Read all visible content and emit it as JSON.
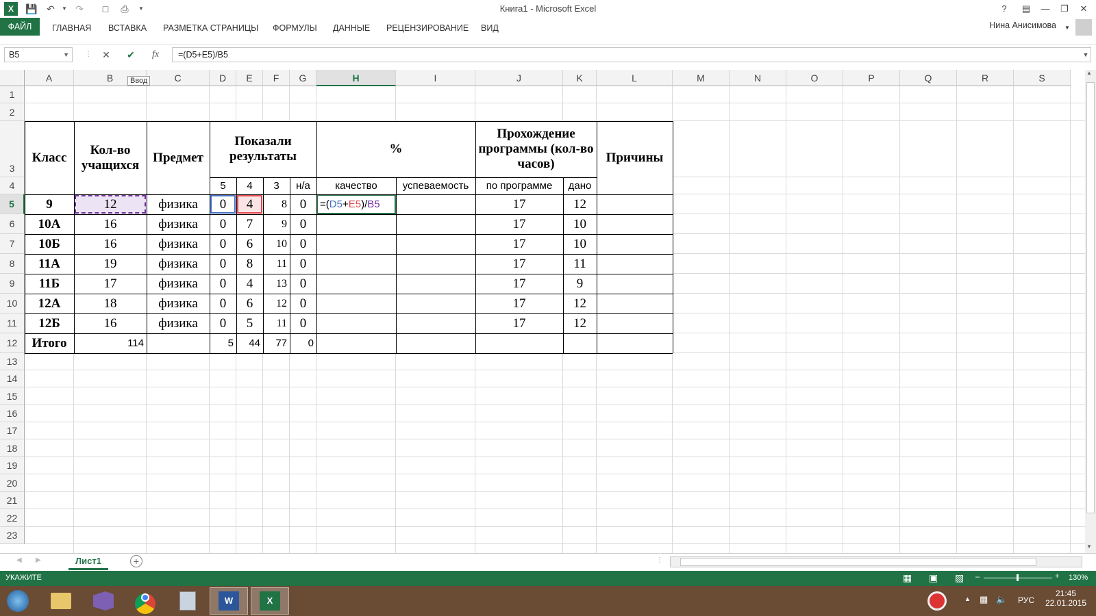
{
  "window": {
    "title": "Книга1 - Microsoft Excel"
  },
  "ribbon": {
    "file": "ФАЙЛ",
    "tabs": [
      "ГЛАВНАЯ",
      "ВСТАВКА",
      "РАЗМЕТКА СТРАНИЦЫ",
      "ФОРМУЛЫ",
      "ДАННЫЕ",
      "РЕЦЕНЗИРОВАНИЕ",
      "ВИД"
    ],
    "user": "Нина Анисимова"
  },
  "formula_bar": {
    "name_box": "B5",
    "formula": "=(D5+E5)/B5",
    "fx": "fx"
  },
  "tooltip": "Ввод",
  "columns": [
    "A",
    "B",
    "C",
    "D",
    "E",
    "F",
    "G",
    "H",
    "I",
    "J",
    "K",
    "L",
    "M",
    "N",
    "O",
    "P",
    "Q",
    "R",
    "S"
  ],
  "rows": [
    "1",
    "2",
    "3",
    "4",
    "5",
    "6",
    "7",
    "8",
    "9",
    "10",
    "11",
    "12",
    "13",
    "14",
    "15",
    "16",
    "17",
    "18",
    "19",
    "20",
    "21",
    "22",
    "23"
  ],
  "table": {
    "h_class": "Класс",
    "h_count": "Кол-во учащихся",
    "h_subject": "Предмет",
    "h_results": "Показали результаты",
    "h_percent": "%",
    "h_program": "Прохождение программы (кол-во часов)",
    "h_reasons": "Причины",
    "sub": {
      "g5": "5",
      "g4": "4",
      "g3": "3",
      "na": "н/а",
      "quality": "качество",
      "success": "успеваемость",
      "by_program": "по программе",
      "given": "дано"
    },
    "rows": [
      {
        "cls": "9",
        "cnt": "12",
        "subj": "физика",
        "d": "0",
        "e": "4",
        "f": "8",
        "g": "0",
        "j": "17",
        "k": "12"
      },
      {
        "cls": "10А",
        "cnt": "16",
        "subj": "физика",
        "d": "0",
        "e": "7",
        "f": "9",
        "g": "0",
        "j": "17",
        "k": "10"
      },
      {
        "cls": "10Б",
        "cnt": "16",
        "subj": "физика",
        "d": "0",
        "e": "6",
        "f": "10",
        "g": "0",
        "j": "17",
        "k": "10"
      },
      {
        "cls": "11А",
        "cnt": "19",
        "subj": "физика",
        "d": "0",
        "e": "8",
        "f": "11",
        "g": "0",
        "j": "17",
        "k": "11"
      },
      {
        "cls": "11Б",
        "cnt": "17",
        "subj": "физика",
        "d": "0",
        "e": "4",
        "f": "13",
        "g": "0",
        "j": "17",
        "k": "9"
      },
      {
        "cls": "12А",
        "cnt": "18",
        "subj": "физика",
        "d": "0",
        "e": "6",
        "f": "12",
        "g": "0",
        "j": "17",
        "k": "12"
      },
      {
        "cls": "12Б",
        "cnt": "16",
        "subj": "физика",
        "d": "0",
        "e": "5",
        "f": "11",
        "g": "0",
        "j": "17",
        "k": "12"
      }
    ],
    "total": {
      "label": "Итого",
      "cnt": "114",
      "d": "5",
      "e": "44",
      "f": "77",
      "g": "0"
    },
    "edit_formula": {
      "eq": "=(",
      "r1": "D5",
      "plus": "+",
      "r2": "E5",
      "div": ")/",
      "r3": "B5"
    }
  },
  "sheets": {
    "tab": "Лист1"
  },
  "status": {
    "mode": "УКАЖИТЕ",
    "zoom": "130%"
  },
  "taskbar": {
    "lang": "РУС",
    "time": "21:45",
    "date": "22.01.2015"
  },
  "colors": {
    "accent": "#217346",
    "ref1": "#4472c4",
    "ref2": "#e0484e",
    "ref3": "#7030a0"
  }
}
